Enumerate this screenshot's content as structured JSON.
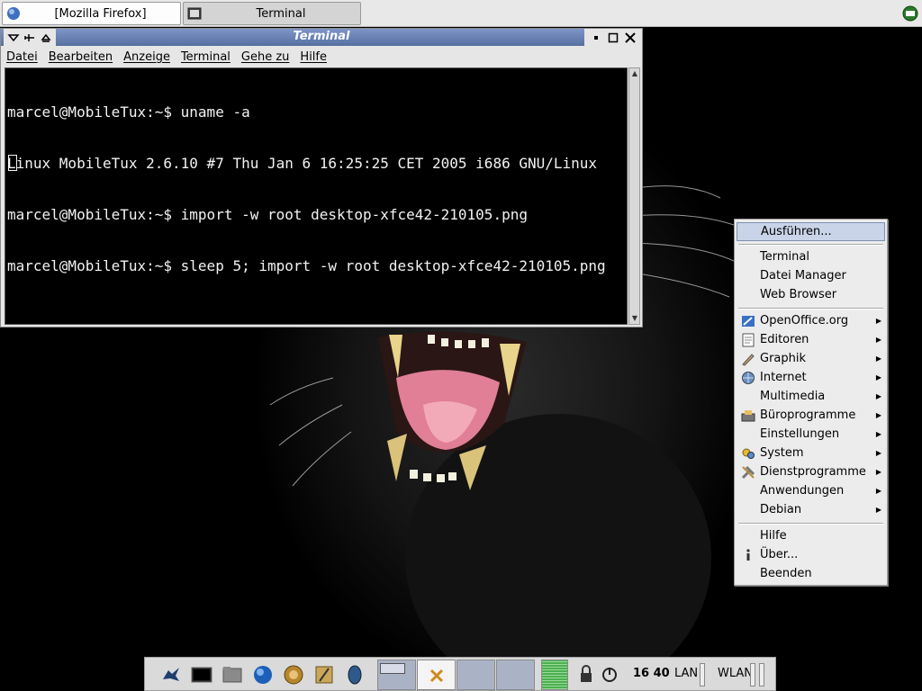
{
  "taskbar": {
    "tasks": [
      {
        "label": "[Mozilla Firefox]"
      },
      {
        "label": "Terminal"
      }
    ]
  },
  "terminal": {
    "title": "Terminal",
    "menu": [
      "Datei",
      "Bearbeiten",
      "Anzeige",
      "Terminal",
      "Gehe zu",
      "Hilfe"
    ],
    "lines": [
      "marcel@MobileTux:~$ uname -a",
      "Linux MobileTux 2.6.10 #7 Thu Jan 6 16:25:25 CET 2005 i686 GNU/Linux",
      "marcel@MobileTux:~$ import -w root desktop-xfce42-210105.png",
      "marcel@MobileTux:~$ sleep 5; import -w root desktop-xfce42-210105.png"
    ]
  },
  "menu": {
    "items": [
      {
        "label": "Ausführen...",
        "icon": "",
        "submenu": false
      },
      {
        "label": "Terminal",
        "icon": "",
        "submenu": false
      },
      {
        "label": "Datei Manager",
        "icon": "",
        "submenu": false
      },
      {
        "label": "Web Browser",
        "icon": "",
        "submenu": false
      },
      {
        "label": "OpenOffice.org",
        "icon": "openoffice-icon",
        "submenu": true
      },
      {
        "label": "Editoren",
        "icon": "editor-icon",
        "submenu": true
      },
      {
        "label": "Graphik",
        "icon": "graphics-icon",
        "submenu": true
      },
      {
        "label": "Internet",
        "icon": "globe-icon",
        "submenu": true
      },
      {
        "label": "Multimedia",
        "icon": "",
        "submenu": true
      },
      {
        "label": "Büroprogramme",
        "icon": "office-icon",
        "submenu": true
      },
      {
        "label": "Einstellungen",
        "icon": "",
        "submenu": true
      },
      {
        "label": "System",
        "icon": "system-icon",
        "submenu": true
      },
      {
        "label": "Dienstprogramme",
        "icon": "tools-icon",
        "submenu": true
      },
      {
        "label": "Anwendungen",
        "icon": "",
        "submenu": true
      },
      {
        "label": "Debian",
        "icon": "",
        "submenu": true
      },
      {
        "label": "Hilfe",
        "icon": "",
        "submenu": false
      },
      {
        "label": "Über...",
        "icon": "info-icon",
        "submenu": false
      },
      {
        "label": "Beenden",
        "icon": "",
        "submenu": false
      }
    ]
  },
  "panel": {
    "clock": "16 40",
    "lan_label": "LAN",
    "wlan_label": "WLAN"
  },
  "colors": {
    "menu_highlight": "#c9d4e8",
    "titlebar": "#6a82b8",
    "terminal_bg": "#000000",
    "terminal_fg": "#f2f2f2"
  }
}
